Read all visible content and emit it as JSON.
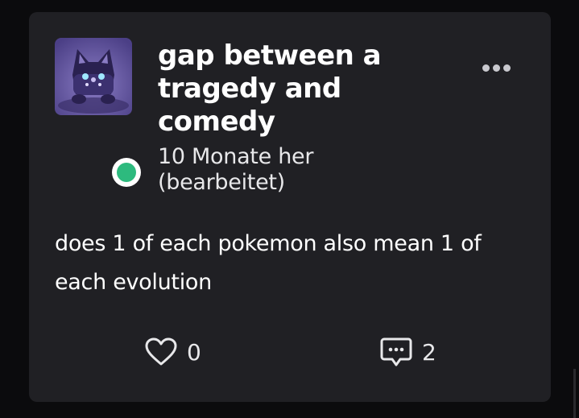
{
  "post": {
    "title": "gap between a tragedy and comedy",
    "timestamp_line1": "10 Monate her",
    "timestamp_line2": "(bearbeitet)",
    "body": "does 1 of each pokemon also mean 1 of each evolution",
    "likes": "0",
    "comments": "2",
    "status": "online"
  },
  "icons": {
    "avatar": "cat-creature-avatar",
    "more": "more-dots-icon",
    "like": "heart-icon",
    "comment": "comment-bubble-icon"
  },
  "colors": {
    "background": "#0b0b0d",
    "card": "#202024",
    "text": "#ffffff",
    "status_online": "#2dba7e"
  }
}
